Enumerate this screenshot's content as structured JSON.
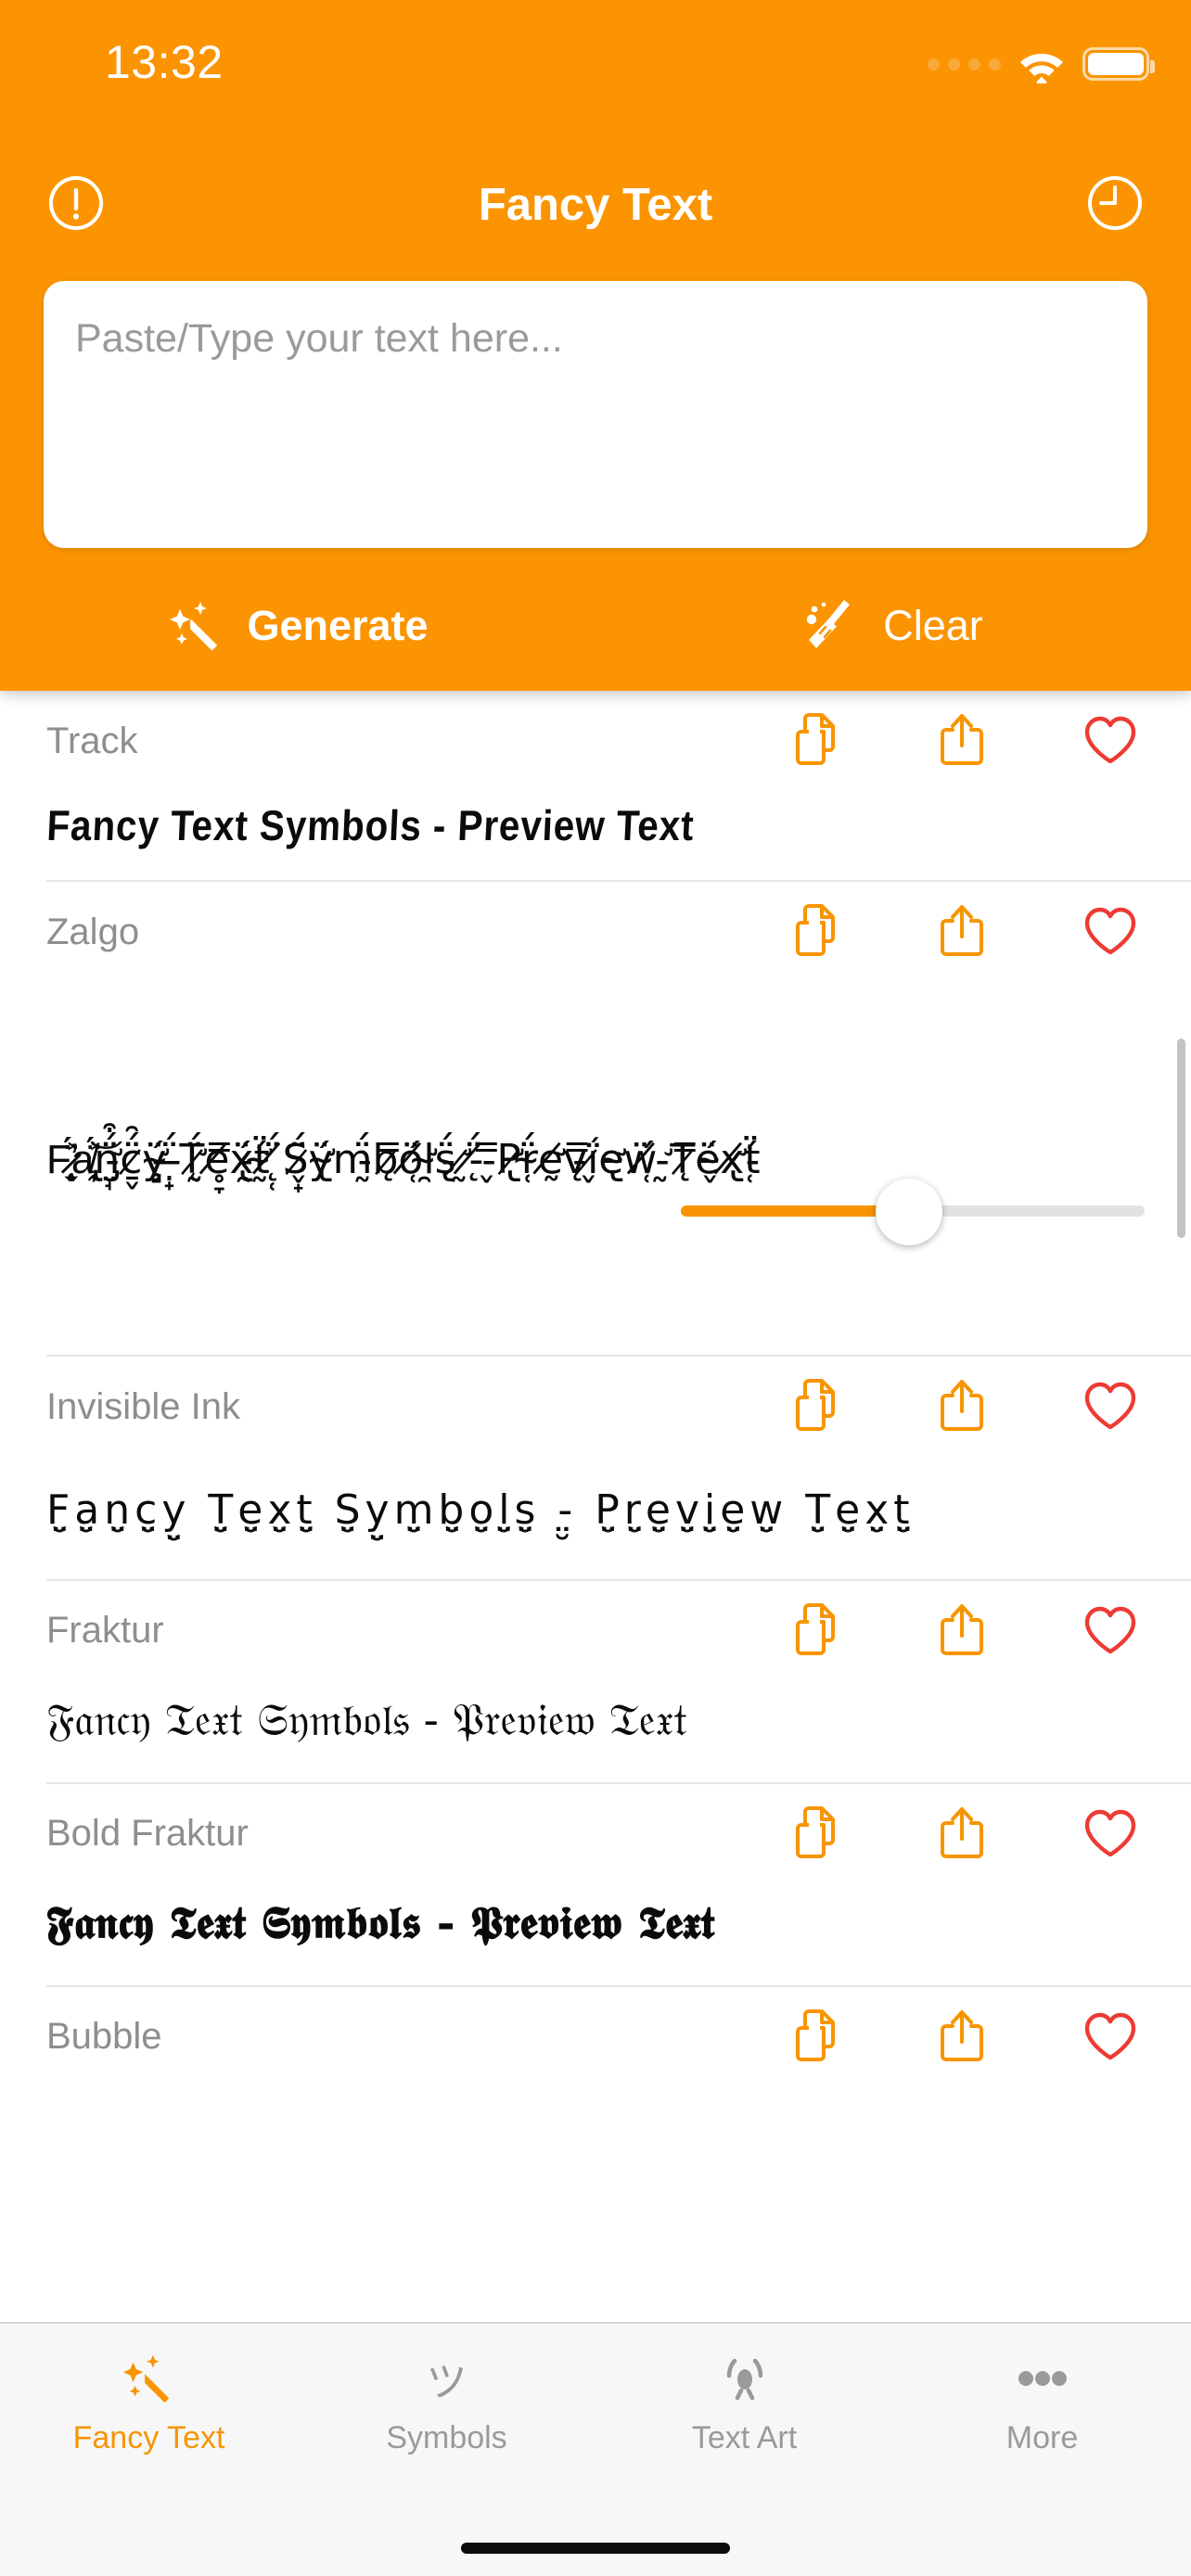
{
  "status_bar": {
    "time": "13:32",
    "signal_icon": "signal-dots-icon",
    "wifi_icon": "wifi-icon",
    "battery_icon": "battery-full-icon"
  },
  "header": {
    "title": "Fancy Text",
    "info_icon": "info-circle-icon",
    "history_icon": "clock-icon",
    "background_color": "#FB9400"
  },
  "input": {
    "placeholder": "Paste/Type your text here...",
    "value": ""
  },
  "actions": {
    "generate_label": "Generate",
    "generate_icon": "magic-wand-sparkles-icon",
    "clear_label": "Clear",
    "clear_icon": "broom-icon"
  },
  "row_icons": {
    "copy_icon": "copy-documents-icon",
    "share_icon": "share-up-arrow-icon",
    "favorite_icon": "heart-outline-icon",
    "copy_color": "#F79500",
    "share_color": "#F79500",
    "favorite_color": "#ED3B34"
  },
  "styles": [
    {
      "name": "Track",
      "preview": "Fancy Text Symbols - Preview Text",
      "has_slider": false
    },
    {
      "name": "Zalgo",
      "preview": "F̷̨̛̜̬̟͎̈́͐̈́a̸̢̯̦͎͐̈́͝n̵̡̛̤̘̈́͒c̷̱̬̈́̑ÿ̴̧̛̻́ ̶̣̟̈́T̷̨̛̰̈́e̸̥̞̿ẍ̵̢̯́ẗ̴̛̰́ ̸̨̜̈́S̷̬̟̈́ÿ̴̢̛́m̵̰̈́b̷̨̿ö̸̜́l̴̛̯s̵̢̈́ ̷̛̰-̸̨̈́ ̵̬̿P̷̢̛r̴̜̈́ḛ̸̛v̵̨̿ḯ̷̬e̴̢̛ẅ̸̜́ ̵̛̰T̷̨̿ë̴̬́x̸̢̛ẗ̵̜́",
      "has_slider": true,
      "slider_value": 48
    },
    {
      "name": "Invisible Ink",
      "preview": "F̤̮a̤̮n̤̮c̤̮y̤̮ T̤̮e̤̮x̤̮t̤̮ S̤̮y̤̮m̤̮b̤̮o̤̮l̤̮s̤̮ -̤̮ P̤̮r̤̮e̤̮v̤̮i̤̮e̤̮w̤̮ T̤̮e̤̮x̤̮t̤̮",
      "has_slider": false
    },
    {
      "name": "Fraktur",
      "preview": "𝔉𝔞𝔫𝔠𝔶 𝔗𝔢𝔵𝔱 𝔖𝔶𝔪𝔟𝔬𝔩𝔰 - 𝔓𝔯𝔢𝔳𝔦𝔢𝔴 𝔗𝔢𝔵𝔱",
      "has_slider": false
    },
    {
      "name": "Bold Fraktur",
      "preview": "𝕱𝖆𝖓𝖈𝖞 𝕿𝖊𝖝𝖙 𝕾𝖞𝖒𝖇𝖔𝖑𝖘 - 𝕻𝖗𝖊𝖛𝖎𝖊𝖜 𝕿𝖊𝖝𝖙",
      "has_slider": false
    },
    {
      "name": "Bubble",
      "preview": "",
      "has_slider": false
    }
  ],
  "tabs": [
    {
      "label": "Fancy Text",
      "icon": "magic-wand-sparkles-icon",
      "active": true
    },
    {
      "label": "Symbols",
      "icon": "katakana-tsu-icon",
      "active": false
    },
    {
      "label": "Text Art",
      "icon": "kaomoji-face-icon",
      "active": false
    },
    {
      "label": "More",
      "icon": "ellipsis-icon",
      "active": false
    }
  ],
  "accent_color": "#F79500",
  "active_tab_color": "#F79500",
  "inactive_tab_color": "#9a9a9a"
}
